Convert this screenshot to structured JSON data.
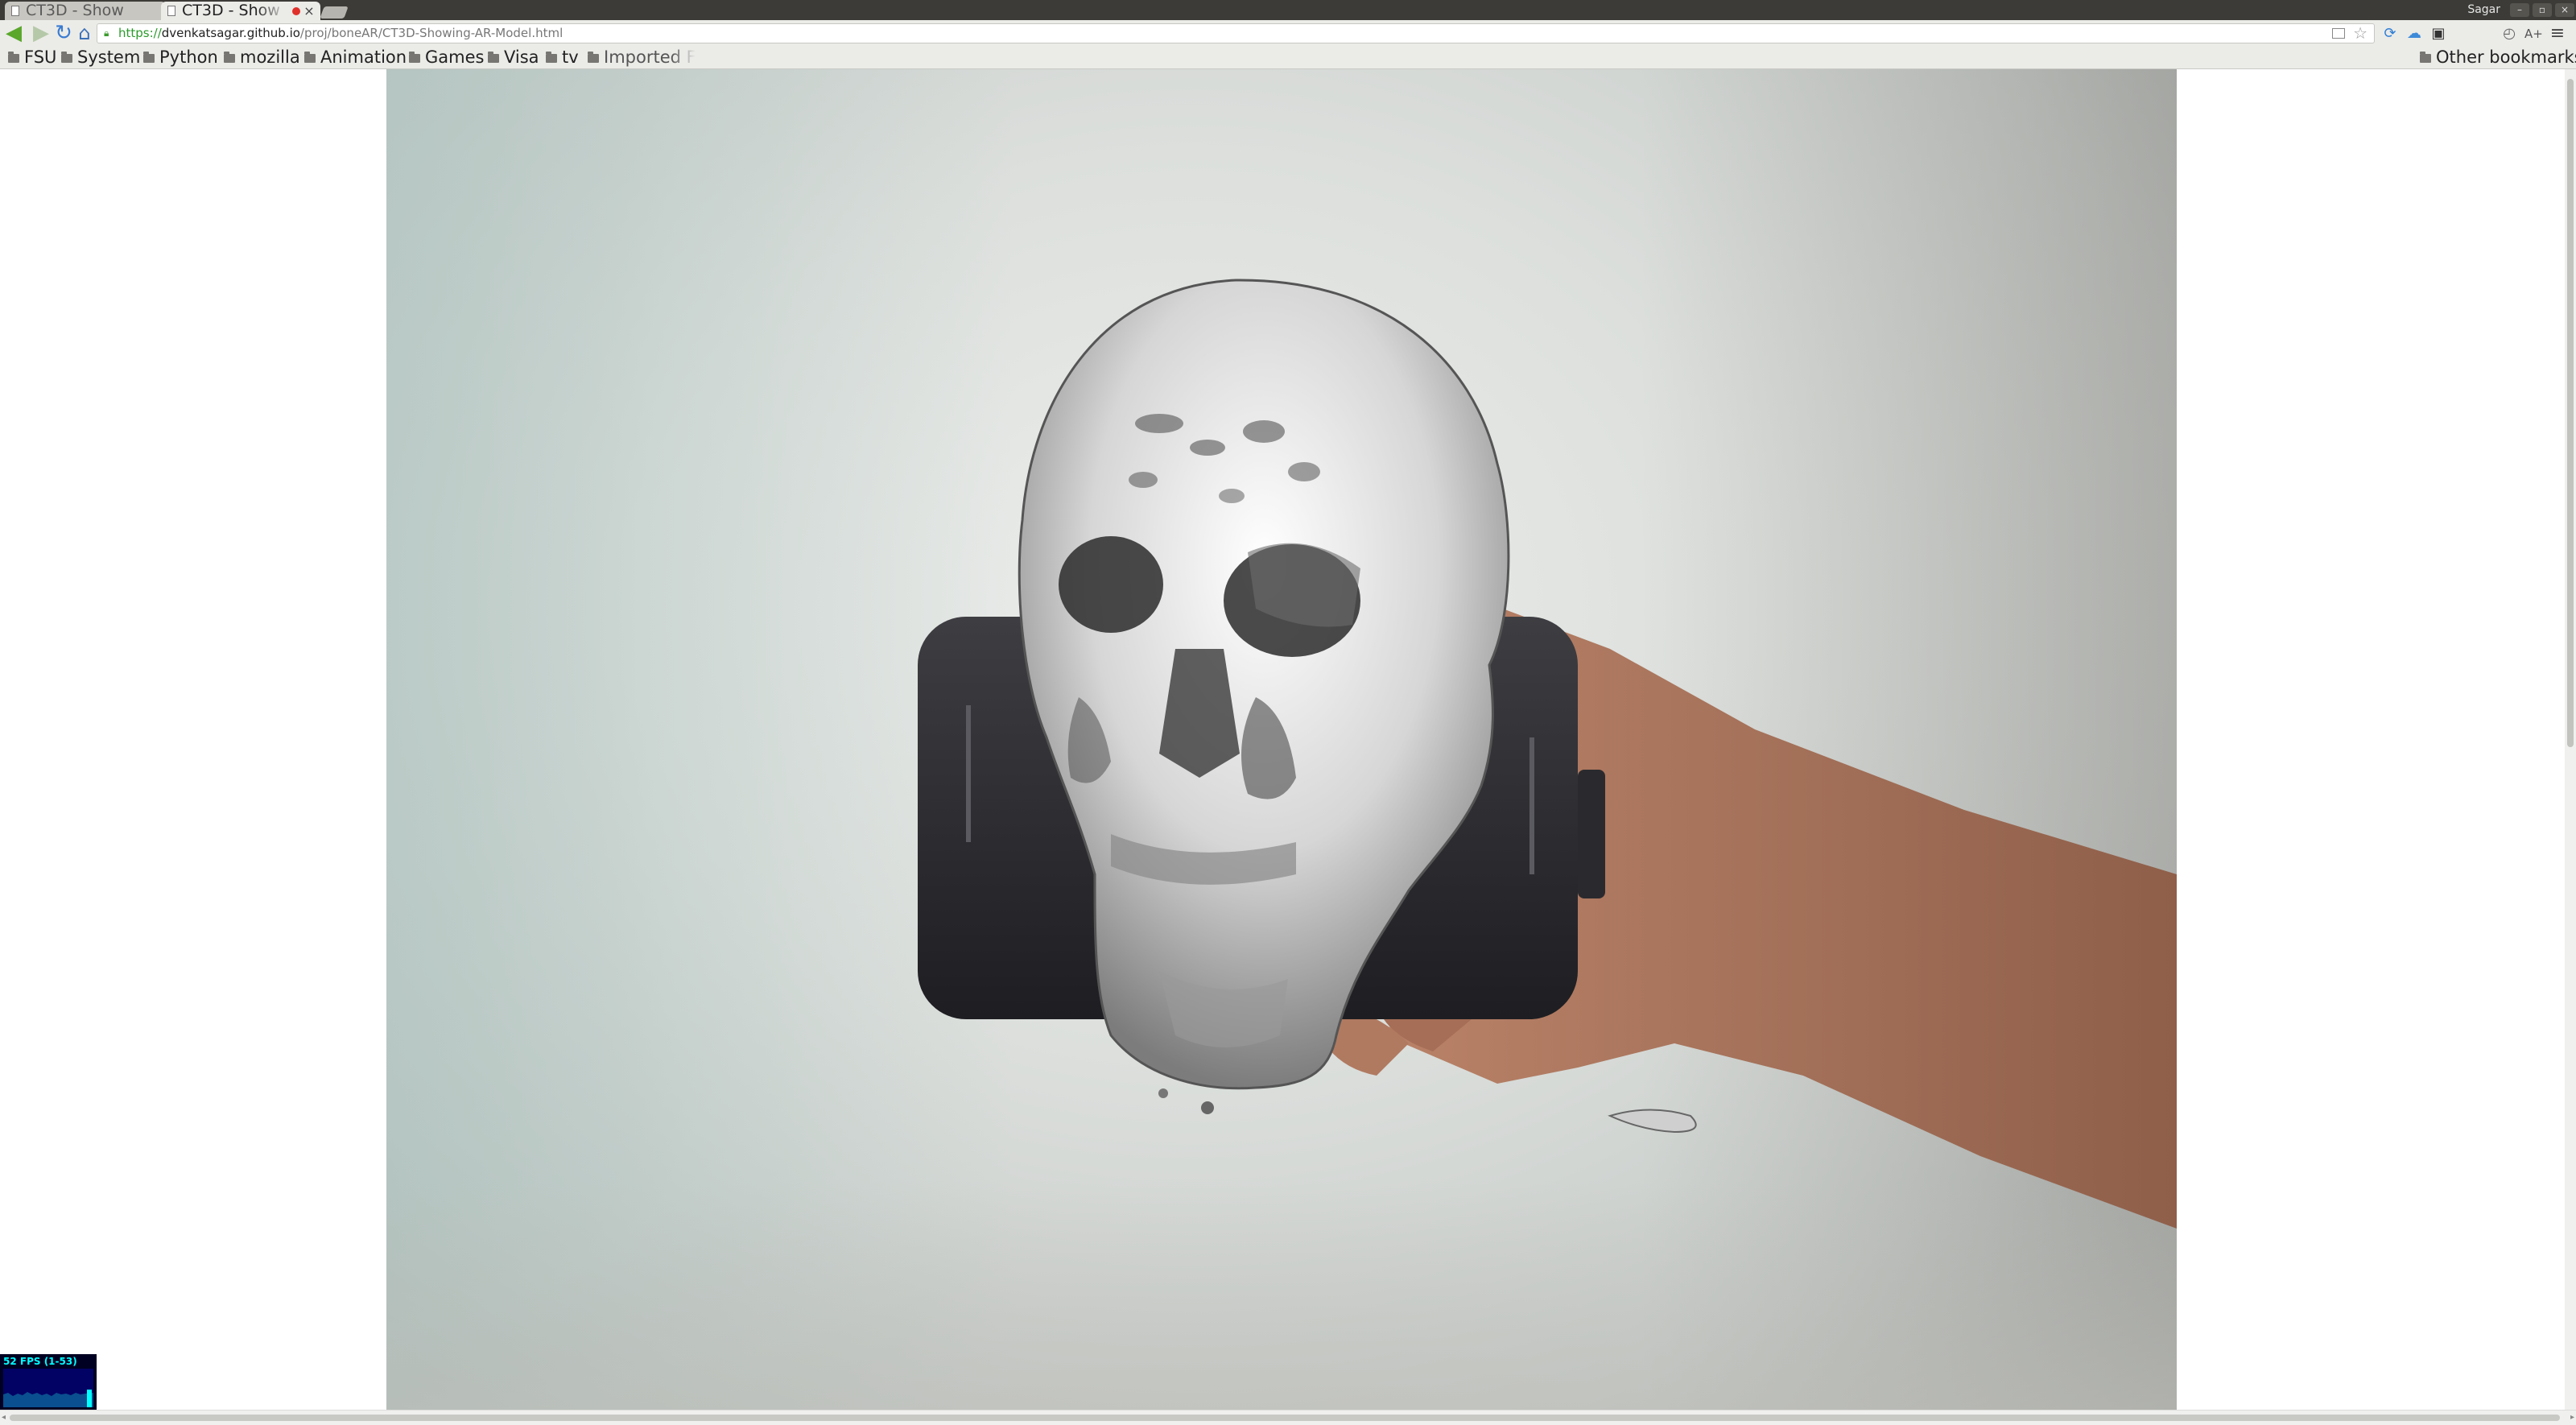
{
  "tabs": [
    {
      "title": "CT3D - Show",
      "active": false
    },
    {
      "title": "CT3D - Show",
      "active": true
    }
  ],
  "window": {
    "profile_name": "Sagar",
    "minimize_label": "–",
    "maximize_label": "▫",
    "close_label": "×"
  },
  "tab_close_label": "×",
  "toolbar": {
    "back_icon": "◀",
    "forward_icon": "▶",
    "reload_icon": "↻",
    "home_icon": "⌂"
  },
  "omnibox": {
    "scheme": "https://",
    "host": "dvenkatsagar.github.io",
    "path": "/proj/boneAR/CT3D-Showing-AR-Model.html",
    "star_icon": "☆"
  },
  "extensions": [
    "cloud-sync-icon",
    "cloud-icon",
    "pocket-icon",
    "clock-icon",
    "font-size-icon",
    "menu-icon"
  ],
  "extension_glyphs": {
    "clock": "◴",
    "font": "A+",
    "menu": "≡",
    "cloud": "☁",
    "sync": "⟳",
    "pocket": "▣"
  },
  "bookmarks": {
    "items": [
      "FSU",
      "System",
      "Python",
      "mozilla",
      "Animation",
      "Games",
      "Visa",
      "tv"
    ],
    "imported_label": "Imported Fr",
    "other_label": "Other bookmarks"
  },
  "stats": {
    "fps_label": "52 FPS (1-53)"
  },
  "colors": {
    "titlebar": "#3c3b37",
    "toolbar": "#ebebe8",
    "fps_panel_bg": "#002",
    "fps_text": "#0ff"
  }
}
